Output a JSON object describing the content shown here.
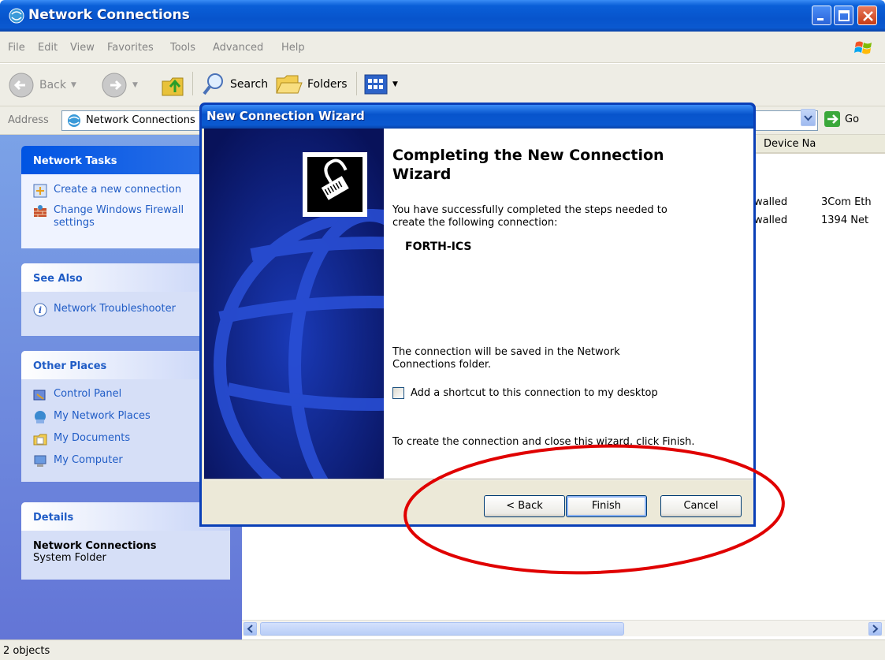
{
  "window": {
    "title": "Network Connections"
  },
  "menu": [
    "File",
    "Edit",
    "View",
    "Favorites",
    "Tools",
    "Advanced",
    "Help"
  ],
  "toolbar": {
    "back": "Back",
    "search": "Search",
    "folders": "Folders"
  },
  "address": {
    "label": "Address",
    "value": "Network Connections",
    "go": "Go"
  },
  "sidebar": {
    "network_tasks": {
      "title": "Network Tasks",
      "items": [
        "Create a new connection",
        "Change Windows Firewall settings"
      ]
    },
    "see_also": {
      "title": "See Also",
      "items": [
        "Network Troubleshooter"
      ]
    },
    "other_places": {
      "title": "Other Places",
      "items": [
        "Control Panel",
        "My Network Places",
        "My Documents",
        "My Computer"
      ]
    },
    "details": {
      "title": "Details",
      "name": "Network Connections",
      "type": "System Folder"
    }
  },
  "list": {
    "column_device": "Device Na",
    "rows": [
      {
        "status": "walled",
        "device": "3Com Eth"
      },
      {
        "status": "walled",
        "device": "1394 Net"
      }
    ]
  },
  "status": {
    "text": "2 objects"
  },
  "wizard": {
    "title": "New Connection Wizard",
    "heading": "Completing the New Connection Wizard",
    "intro": "You have successfully completed the steps needed to create the following connection:",
    "connection_name": "FORTH-ICS",
    "saved_note": "The connection will be saved in the Network Connections folder.",
    "checkbox_label": "Add a shortcut to this connection to my desktop",
    "instruction": "To create the connection and close this wizard, click Finish.",
    "buttons": {
      "back": "< Back",
      "finish": "Finish",
      "cancel": "Cancel"
    }
  },
  "colors": {
    "title_blue": "#0754cc",
    "panel_blue": "#215dc6",
    "annotation_red": "#e00000"
  }
}
